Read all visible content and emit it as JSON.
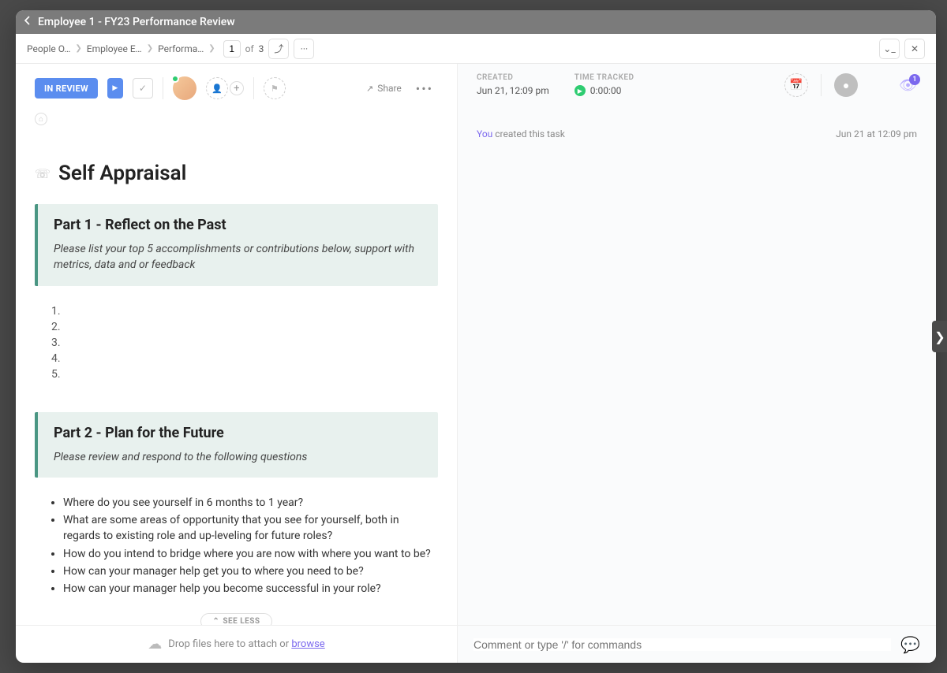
{
  "title": "Employee 1 - FY23 Performance Review",
  "breadcrumbs": [
    "People O…",
    "Employee E…",
    "Performa…"
  ],
  "pager": {
    "current": "1",
    "of_label": "of",
    "total": "3"
  },
  "status": {
    "label": "IN REVIEW"
  },
  "share_label": "Share",
  "meta": {
    "created": {
      "label": "CREATED",
      "value": "Jun 21, 12:09 pm"
    },
    "time_tracked": {
      "label": "TIME TRACKED",
      "value": "0:00:00"
    }
  },
  "watchers": "1",
  "doc": {
    "title": "Self Appraisal",
    "part1": {
      "heading": "Part 1 - Reflect on the Past",
      "prompt": "Please list your top 5 accomplishments or contributions below, support with metrics, data and or feedback"
    },
    "part2": {
      "heading": "Part 2 - Plan for the Future",
      "prompt": "Please review and respond to the following questions",
      "questions": [
        "Where do you see yourself in 6 months to 1 year?",
        " What are some areas of opportunity that you see for yourself, both in regards to existing role and up-leveling for future roles?",
        " How do you intend to bridge where you are now with where you want to be?",
        " How can your manager help get you to where you need to be?",
        " How can your manager help you become successful in your role?"
      ]
    },
    "see_less": "SEE LESS"
  },
  "activity": {
    "you": "You",
    "action": " created this task",
    "time": "Jun 21 at 12:09 pm"
  },
  "attach": {
    "text": "Drop files here to attach or ",
    "browse": "browse"
  },
  "comment": {
    "placeholder": "Comment or type '/' for commands"
  }
}
